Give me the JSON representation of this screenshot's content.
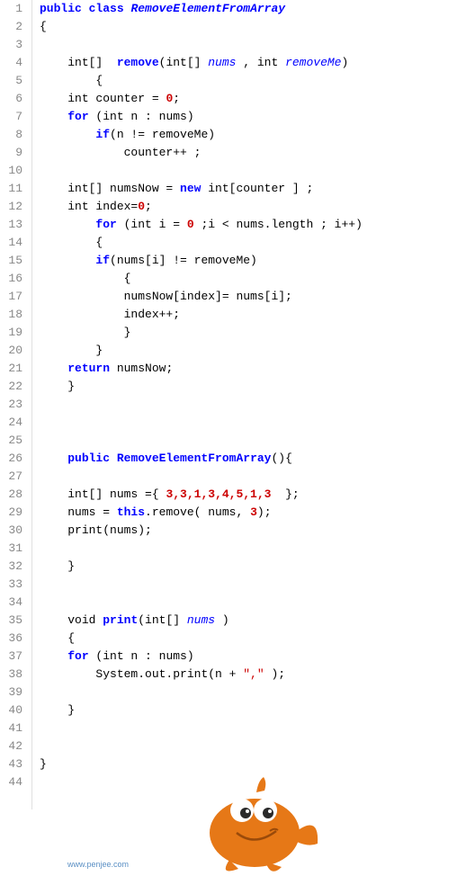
{
  "lines": [
    {
      "n": 1
    },
    {
      "n": 2
    },
    {
      "n": 3
    },
    {
      "n": 4
    },
    {
      "n": 5
    },
    {
      "n": 6
    },
    {
      "n": 7
    },
    {
      "n": 8
    },
    {
      "n": 9
    },
    {
      "n": 10
    },
    {
      "n": 11
    },
    {
      "n": 12
    },
    {
      "n": 13
    },
    {
      "n": 14
    },
    {
      "n": 15
    },
    {
      "n": 16
    },
    {
      "n": 17
    },
    {
      "n": 18
    },
    {
      "n": 19
    },
    {
      "n": 20
    },
    {
      "n": 21
    },
    {
      "n": 22
    },
    {
      "n": 23
    },
    {
      "n": 24
    },
    {
      "n": 25
    },
    {
      "n": 26
    },
    {
      "n": 27
    },
    {
      "n": 28
    },
    {
      "n": 29
    },
    {
      "n": 30
    },
    {
      "n": 31
    },
    {
      "n": 32
    },
    {
      "n": 33
    },
    {
      "n": 34
    },
    {
      "n": 35
    },
    {
      "n": 36
    },
    {
      "n": 37
    },
    {
      "n": 38
    },
    {
      "n": 39
    },
    {
      "n": 40
    },
    {
      "n": 41
    },
    {
      "n": 42
    },
    {
      "n": 43
    },
    {
      "n": 44
    }
  ],
  "code": {
    "l1": {
      "kw1": "public",
      "kw2": "class",
      "classname": "RemoveElementFromArray"
    },
    "l2": {
      "brace": "{"
    },
    "l4": {
      "t1": "int[]  ",
      "m": "remove",
      "t2": "(int[] ",
      "p1": "nums",
      "t3": " , int ",
      "p2": "removeMe",
      "t4": ")"
    },
    "l5": {
      "brace": "{"
    },
    "l6": {
      "t1": "int counter = ",
      "n": "0",
      "t2": ";"
    },
    "l7": {
      "kw": "for",
      "t": " (int n : nums)"
    },
    "l8": {
      "kw": "if",
      "t": "(n != removeMe)"
    },
    "l9": {
      "t": "counter++ ;"
    },
    "l11": {
      "t1": "int[] numsNow = ",
      "kw": "new",
      "t2": " int[counter ] ;"
    },
    "l12": {
      "t1": "int index=",
      "n": "0",
      "t2": ";"
    },
    "l13": {
      "kw": "for",
      "t1": " (int i = ",
      "n": "0",
      "t2": " ;i < nums.length ; i++)"
    },
    "l14": {
      "brace": "{"
    },
    "l15": {
      "kw": "if",
      "t": "(nums[i] != removeMe)"
    },
    "l16": {
      "brace": "{"
    },
    "l17": {
      "t": "numsNow[index]= nums[i];"
    },
    "l18": {
      "t": "index++;"
    },
    "l19": {
      "brace": "}"
    },
    "l20": {
      "brace": "}"
    },
    "l21": {
      "kw": "return",
      "t": " numsNow;"
    },
    "l22": {
      "brace": "}"
    },
    "l26": {
      "kw": "public",
      "classname": "RemoveElementFromArray",
      "t": "(){"
    },
    "l28": {
      "t1": "int[] nums ={ ",
      "nums": "3,3,1,3,4,5,1,3",
      "t2": "  };"
    },
    "l29": {
      "t1": "nums = ",
      "this": "this",
      "t2": ".remove( nums, ",
      "n": "3",
      "t3": ");"
    },
    "l30": {
      "t": "print(nums);"
    },
    "l32": {
      "brace": "}"
    },
    "l35": {
      "t1": "void ",
      "m": "print",
      "t2": "(int[] ",
      "p": "nums",
      "t3": " )"
    },
    "l36": {
      "brace": "{"
    },
    "l37": {
      "kw": "for",
      "t": " (int n : nums)"
    },
    "l38": {
      "t1": "System.out.print(n + ",
      "s": "\",\"",
      "t2": " );"
    },
    "l40": {
      "brace": "}"
    },
    "l43": {
      "brace": "}"
    }
  },
  "url": "www.penjee.com"
}
